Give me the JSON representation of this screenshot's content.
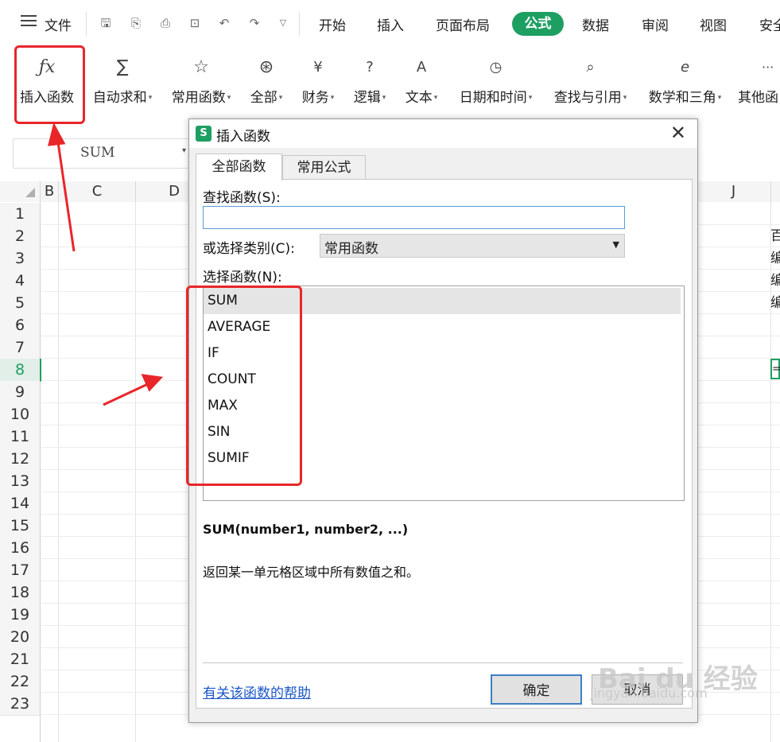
{
  "menubar": {
    "file": "文件",
    "tabs": [
      "开始",
      "插入",
      "页面布局",
      "数据",
      "审阅",
      "视图",
      "安全"
    ],
    "active_tab": "公式",
    "accent": "#1e9f62"
  },
  "ribbon": {
    "insert_function": "插入函数",
    "autosum": "自动求和",
    "common_functions": "常用函数",
    "all": "全部",
    "finance": "财务",
    "logic": "逻辑",
    "text": "文本",
    "datetime": "日期和时间",
    "lookup": "查找与引用",
    "math": "数学和三角",
    "other": "其他函"
  },
  "namebox": {
    "value": "SUM"
  },
  "grid": {
    "columns": [
      "B",
      "C",
      "D",
      "J"
    ],
    "rows": [
      "1",
      "2",
      "3",
      "4",
      "5",
      "6",
      "7",
      "8",
      "9",
      "10",
      "11",
      "12",
      "13",
      "14",
      "15",
      "16",
      "17",
      "18",
      "19",
      "20",
      "21",
      "22",
      "23"
    ],
    "active_row": "8"
  },
  "dialog": {
    "title": "插入函数",
    "logo": "S",
    "close": "✕",
    "tabs": {
      "all": "全部函数",
      "common": "常用公式"
    },
    "search_label": "查找函数(S):",
    "category_label": "或选择类别(C):",
    "category_value": "常用函数",
    "list_label": "选择函数(N):",
    "functions": [
      "SUM",
      "AVERAGE",
      "IF",
      "COUNT",
      "MAX",
      "SIN",
      "SUMIF"
    ],
    "selected_function": "SUM",
    "signature": "SUM(number1, number2, ...)",
    "description": "返回某一单元格区域中所有数值之和。",
    "help_link": "有关该函数的帮助",
    "ok": "确定",
    "cancel": "取消"
  },
  "watermark": {
    "brand": "Bai du 经验",
    "url": "jingyan.baidu.com"
  },
  "annotation_color": "#e8262a"
}
